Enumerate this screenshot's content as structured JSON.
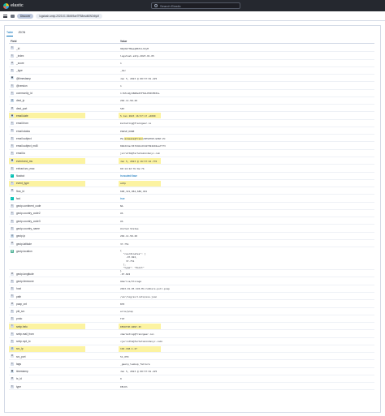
{
  "header": {
    "brand": "elastic",
    "search_placeholder": "Search Elastic"
  },
  "breadcrumbs": [
    "Discover",
    "logstash-smtp-2023.01.05#N9ae7FB8esdt6W3r6yM"
  ],
  "tabs": [
    {
      "label": "Table",
      "active": true
    },
    {
      "label": "JSON",
      "active": false
    }
  ],
  "table": {
    "col_field": "Field",
    "col_value": "Value",
    "rows": [
      {
        "type": "str",
        "icon": "t",
        "field": "_id",
        "value": "9Nj0m77BeeqB6TnLh3yM",
        "highlight": false
      },
      {
        "type": "str",
        "icon": "t",
        "field": "_index",
        "value": "logstash-smtp-2023.01.05",
        "highlight": false
      },
      {
        "type": "num",
        "icon": "#",
        "field": "_score",
        "value": "1",
        "highlight": false
      },
      {
        "type": "str",
        "icon": "t",
        "field": "_type",
        "value": "_doc",
        "highlight": false
      },
      {
        "type": "date",
        "icon": "▣",
        "field": "@timestamp",
        "value": "Jan 5, 2023 @ 00:57:01.225",
        "highlight": false
      },
      {
        "type": "str",
        "icon": "t",
        "field": "@version",
        "value": "1",
        "highlight": false
      },
      {
        "type": "str",
        "icon": "t",
        "field": "community_id",
        "value": "1:8ZxuQyh8W8e0tF6kLP0IhMD34+",
        "highlight": false
      },
      {
        "type": "ip",
        "icon": "◎",
        "field": "dest_ip",
        "value": "204.11.58.28",
        "highlight": false
      },
      {
        "type": "num",
        "icon": "#",
        "field": "dest_port",
        "value": "587",
        "highlight": false
      },
      {
        "type": "date",
        "icon": "▣",
        "field": "email.date",
        "value": "5 Jan 2023 16:57:17 +0000",
        "highlight": true
      },
      {
        "type": "str",
        "icon": "t",
        "field": "email.from",
        "value": "marketing@frenzgear.io",
        "highlight": false
      },
      {
        "type": "str",
        "icon": "t",
        "field": "email.status",
        "value": "PARSE_DONE",
        "highlight": false
      },
      {
        "type": "str",
        "icon": "t",
        "field": "email.subject",
        "value_pre": "PW_",
        "value_hl": "mcmeeks@frenz",
        "value_post": "/DESKTOP-WIN7-PC",
        "highlight": false
      },
      {
        "type": "str",
        "icon": "t",
        "field": "email.subject_md5",
        "value": "8b6d13ac36f24b1d7e9fd94b02aa77f3",
        "highlight": false
      },
      {
        "type": "str",
        "icon": "t",
        "field": "email.to",
        "value": "jarrettm@farhotomindsnyc.com",
        "highlight": false
      },
      {
        "type": "date",
        "icon": "▣",
        "field": "event.end_ms",
        "value": "Jan 5, 2023 @ 16:57:16.776",
        "highlight": true
      },
      {
        "type": "str",
        "icon": "t",
        "field": "extract.src_mac",
        "value": "00:14:22:7b:9e:7b",
        "highlight": false
      },
      {
        "type": "bool",
        "icon": "✓",
        "field": "flowbot",
        "value": "truncated:flase",
        "link": true,
        "highlight": false
      },
      {
        "type": "str",
        "icon": "t",
        "field": "event_type",
        "value": "smtp",
        "highlight": true
      },
      {
        "type": "num",
        "icon": "#",
        "field": "flow_id",
        "value": "698,321,984,686,491",
        "highlight": false
      },
      {
        "type": "bool",
        "icon": "✓",
        "field": "fwd",
        "value": "true",
        "link": true,
        "highlight": false
      },
      {
        "type": "str",
        "icon": "t",
        "field": "geoip.continent_code",
        "value": "NA",
        "highlight": false
      },
      {
        "type": "str",
        "icon": "t",
        "field": "geoip.country_code2",
        "value": "US",
        "highlight": false
      },
      {
        "type": "str",
        "icon": "t",
        "field": "geoip.country_code3",
        "value": "US",
        "highlight": false
      },
      {
        "type": "str",
        "icon": "t",
        "field": "geoip.country_name",
        "value": "United States",
        "highlight": false
      },
      {
        "type": "ip",
        "icon": "◎",
        "field": "geoip.ip",
        "value": "204.11.58.28",
        "highlight": false
      },
      {
        "type": "num",
        "icon": "#",
        "field": "geoip.latitude",
        "value": "37.751",
        "highlight": false
      },
      {
        "type": "geo",
        "icon": "◆",
        "field": "geoip.location",
        "value": "{\n  \"coordinates\": [\n    -97.822,\n    37.751\n  ],\n  \"type\": \"Point\"\n}",
        "multi": true,
        "highlight": false
      },
      {
        "type": "num",
        "icon": "#",
        "field": "geoip.longitude",
        "value": "-97.822",
        "highlight": false
      },
      {
        "type": "str",
        "icon": "t",
        "field": "geoip.timezone",
        "value": "America/Chicago",
        "highlight": false
      },
      {
        "type": "str",
        "icon": "t",
        "field": "host",
        "value": "2023-01-05-SCR-MicroShare-pull.pcap",
        "highlight": false
      },
      {
        "type": "str",
        "icon": "t",
        "field": "path",
        "value": "/var/log/suricata/eve.json",
        "highlight": false
      },
      {
        "type": "num",
        "icon": "#",
        "field": "pcap_cnt",
        "value": "870",
        "highlight": false
      },
      {
        "type": "str",
        "icon": "t",
        "field": "pkt_src",
        "value": "wire/pcap",
        "highlight": false
      },
      {
        "type": "str",
        "icon": "t",
        "field": "proto",
        "value": "TCP",
        "highlight": false
      },
      {
        "type": "str",
        "icon": "t",
        "field": "smtp.helo",
        "value": "DESKTOP-WIN7-PC",
        "highlight": true
      },
      {
        "type": "str",
        "icon": "t",
        "field": "smtp.mail_from",
        "value": "<marketing@frenzgear.io>",
        "highlight": false
      },
      {
        "type": "str",
        "icon": "t",
        "field": "smtp.rcpt_to",
        "value": "<jarrettm@farhotomindsnyc.com>",
        "highlight": false
      },
      {
        "type": "ip",
        "icon": "◎",
        "field": "src_ip",
        "value": "192.168.1.27",
        "highlight": true
      },
      {
        "type": "num",
        "icon": "#",
        "field": "src_port",
        "value": "51,055",
        "highlight": false
      },
      {
        "type": "str",
        "icon": "t",
        "field": "tags",
        "value": "_geoip_lookup_failure",
        "highlight": false
      },
      {
        "type": "date",
        "icon": "▣",
        "field": "timestamp",
        "value": "Jan 5, 2023 @ 00:57:01.225",
        "highlight": false
      },
      {
        "type": "num",
        "icon": "#",
        "field": "tx_id",
        "value": "0",
        "highlight": false
      },
      {
        "type": "str",
        "icon": "t",
        "field": "type",
        "value": "DELKS",
        "highlight": false
      }
    ]
  }
}
